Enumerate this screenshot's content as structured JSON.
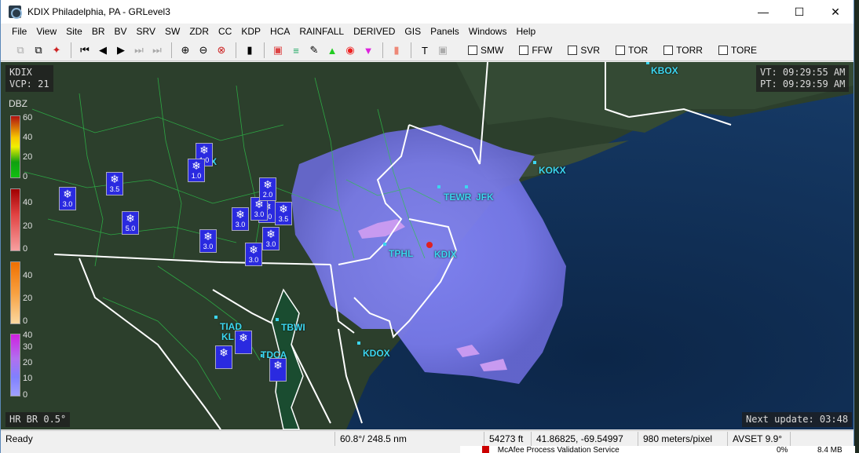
{
  "window": {
    "title": "KDIX Philadelphia, PA - GRLevel3",
    "minimize": "—",
    "maximize": "☐",
    "close": "✕"
  },
  "menu": [
    "File",
    "View",
    "Site",
    "BR",
    "BV",
    "SRV",
    "SW",
    "ZDR",
    "CC",
    "KDP",
    "HCA",
    "RAINFALL",
    "DERIVED",
    "GIS",
    "Panels",
    "Windows",
    "Help"
  ],
  "toolbar": {
    "checks": [
      "SMW",
      "FFW",
      "SVR",
      "TOR",
      "TORR",
      "TORE"
    ]
  },
  "info": {
    "site": "KDIX",
    "vcp": "VCP: 21",
    "vt": "VT: 09:29:55 AM",
    "pt": "PT: 09:29:59 AM",
    "product": "HR BR 0.5°",
    "next_update": "Next update: 03:48"
  },
  "legend": {
    "title": "DBZ",
    "scale1": [
      "60",
      "40",
      "20",
      "0"
    ],
    "scale2": [
      "40",
      "20",
      "0"
    ],
    "scale3": [
      "40",
      "20",
      "0"
    ],
    "scale4": [
      "40",
      "30",
      "20",
      "10",
      "0"
    ]
  },
  "sites": {
    "kbox": "KBOX",
    "kokx": "KOKX",
    "tewr": "TEWR",
    "jfk": "JFK",
    "tphl": "TPHL",
    "kdix": "KDIX",
    "kdox": "KDOX",
    "tbwi": "TBWI",
    "tiad": "TIAD",
    "kl": "KL",
    "tdca": "TDCA",
    "x": "X"
  },
  "snow_values": [
    "1.0",
    "1.0",
    "3.5",
    "3.0",
    "5.0",
    "3.0",
    "3.0",
    "3.0",
    "3.5",
    "4.0",
    "3.0",
    "3.0",
    "2.0"
  ],
  "status": {
    "ready": "Ready",
    "bearing": "60.8°/ 248.5 nm",
    "altitude": "54273 ft",
    "coords": "41.86825, -69.54997",
    "resolution": "980 meters/pixel",
    "avset": "AVSET 9.9°"
  },
  "taskbar": {
    "process": "McAfee Process Validation Service",
    "cpu": "0%",
    "mem": "8.4 MB"
  },
  "colors": {
    "radar_light": "#9a9aff",
    "radar_mid": "#7070e8",
    "site_label": "#3cd6f0",
    "snow_icon": "#2a2ae0",
    "border_white": "#ffffff",
    "county_green": "#2ec24a"
  }
}
